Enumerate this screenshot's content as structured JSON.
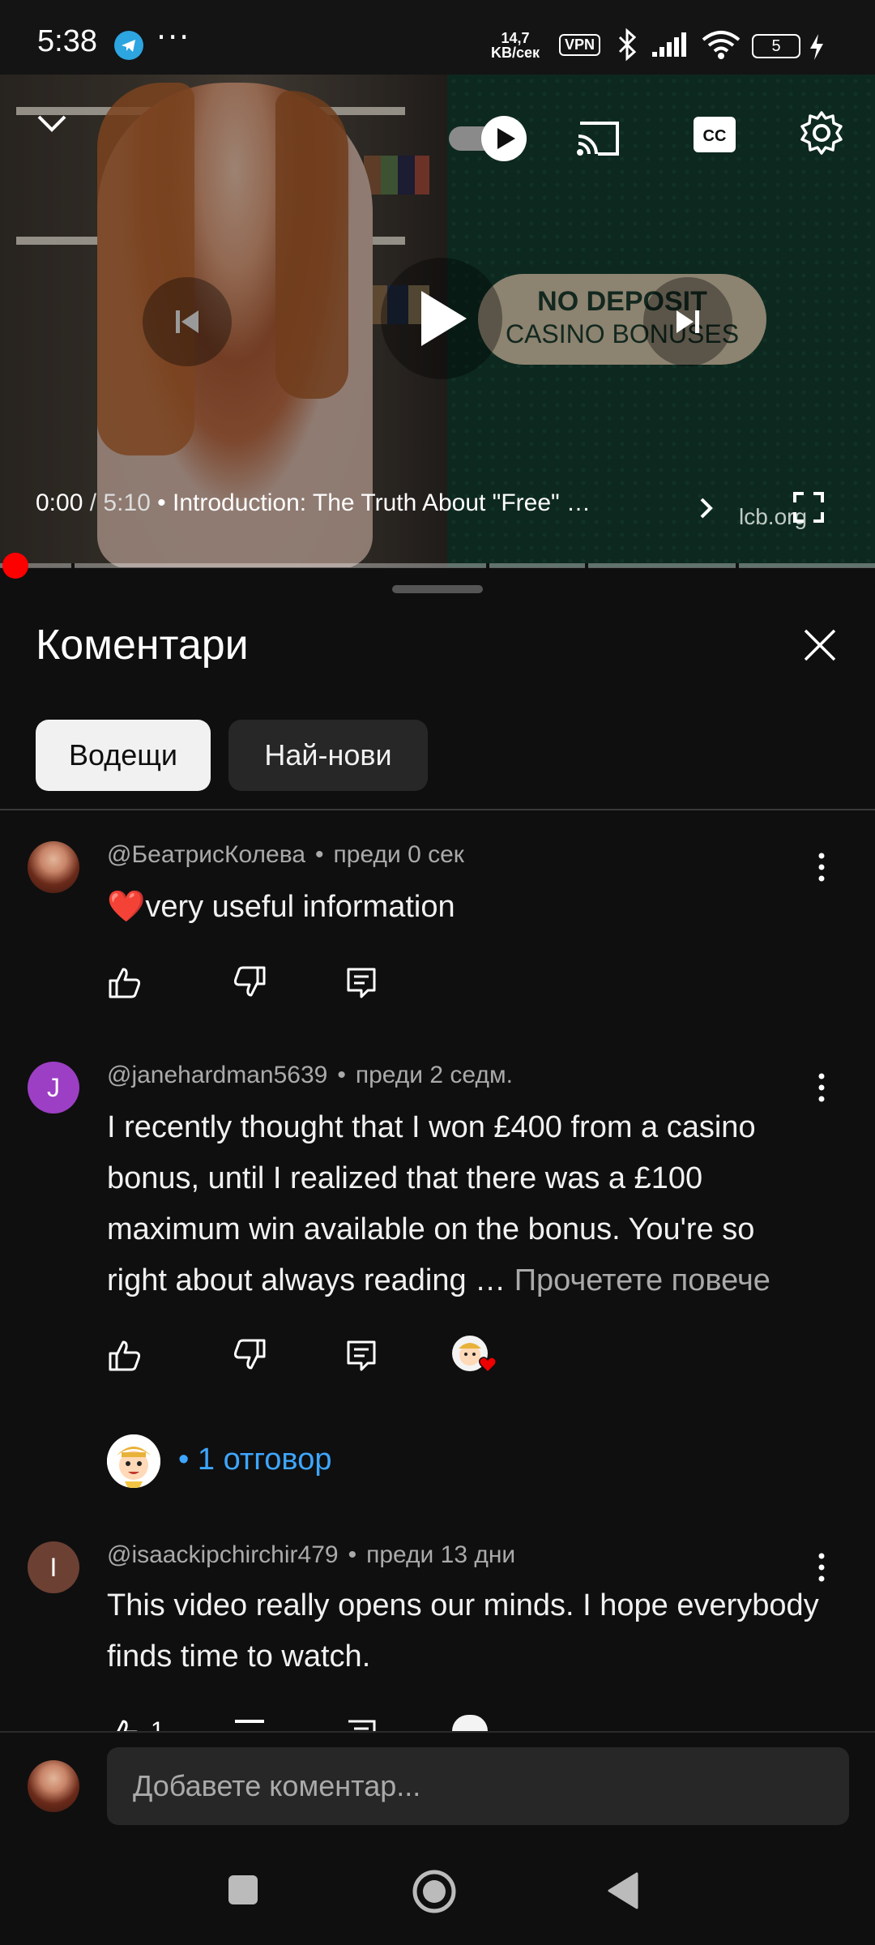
{
  "status_bar": {
    "time": "5:38",
    "dots": "···",
    "speed_value": "14,7",
    "speed_unit": "KB/сек",
    "vpn": "VPN",
    "battery": "5",
    "icons": [
      "telegram-icon",
      "more-dots",
      "bluetooth-icon",
      "signal-icon",
      "wifi-icon",
      "battery-icon",
      "charging-icon"
    ]
  },
  "player": {
    "current_time": "0:00",
    "separator": " / ",
    "duration": "5:10",
    "chapter_prefix": " • ",
    "chapter": "Introduction: The Truth About \"Free\" …",
    "badge_line1": "NO DEPOSIT",
    "badge_line2": "CASINO BONUSES",
    "watermark": "lcb.org",
    "icons": [
      "chevron-down-icon",
      "autoplay-toggle",
      "cast-icon",
      "cc-icon",
      "settings-icon",
      "previous-icon",
      "play-icon",
      "next-icon",
      "chevron-right-icon",
      "fullscreen-icon"
    ]
  },
  "comments_panel": {
    "title": "Коментари",
    "chips": {
      "top": "Водещи",
      "newest": "Най-нови"
    },
    "comments": [
      {
        "author": "@БеатрисКолева",
        "bullet": "•",
        "time": "преди 0 сек",
        "text": "❤️very useful information"
      },
      {
        "author": "@janehardman5639",
        "bullet": "•",
        "time": "преди 2 седм.",
        "avatar_letter": "J",
        "text": "I recently thought that I won £400 from a casino bonus, until I realized that there was a £100 maximum win available on the bonus. You're so right about always reading …",
        "read_more": "Прочетете повече",
        "reply_bullet": "•",
        "replies": "1 отговор"
      },
      {
        "author": "@isaackipchirchir479",
        "bullet": "•",
        "time": "преди 13 дни",
        "avatar_letter": "I",
        "text": "This video really opens our minds. I hope everybody finds time to watch.",
        "likes": "1"
      }
    ],
    "composer_placeholder": "Добавете коментар..."
  },
  "colors": {
    "background": "#0f0f0f",
    "accent_link": "#3ea6ff",
    "progress_red": "#ff0000",
    "chip_active": "#f1f1f1",
    "chip_idle": "#272727"
  }
}
